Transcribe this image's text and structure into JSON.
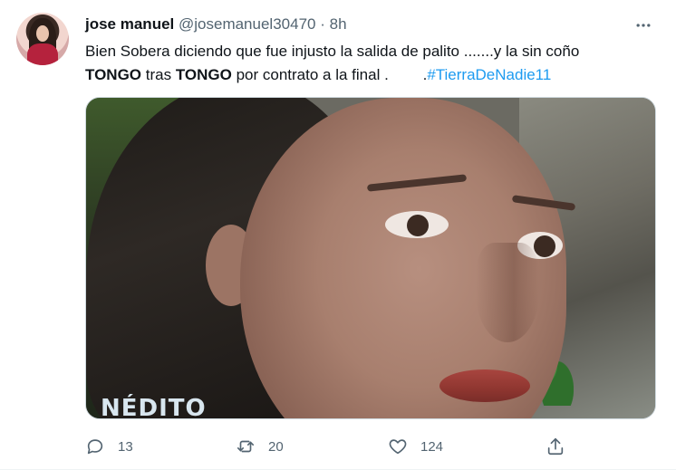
{
  "tweet": {
    "author_name": "jose manuel",
    "handle": "@josemanuel30470",
    "separator": "·",
    "time": "8h",
    "more_icon": "more-horizontal-icon",
    "text_line1": "Bien Sobera diciendo que fue injusto la salida de palito .......y la sin coño",
    "text_bold1": "TONGO",
    "text_mid": " tras ",
    "text_bold2": "TONGO",
    "text_tail": " por contrato a la final .        .",
    "hashtag": "#TierraDeNadie11",
    "media_caption_fragment": "NÉDITO"
  },
  "actions": {
    "reply_count": "13",
    "retweet_count": "20",
    "like_count": "124"
  },
  "colors": {
    "accent": "#1d9bf0",
    "secondary_text": "#536471",
    "primary_text": "#0f1419"
  }
}
